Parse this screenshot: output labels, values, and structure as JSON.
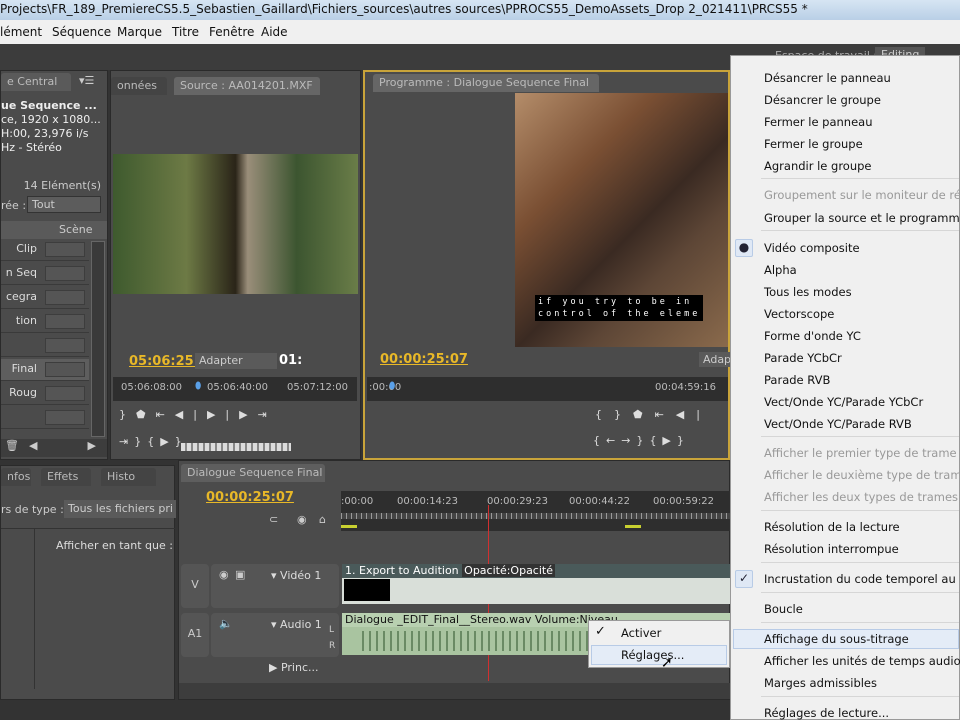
{
  "window": {
    "title": "Projects\\FR_189_PremiereCS5.5_Sebastien_Gaillard\\Fichiers_sources\\autres sources\\PPROCS55_DemoAssets_Drop 2_021411\\PRCS55 *"
  },
  "menu": [
    "lément",
    "Séquence",
    "Marque",
    "Titre",
    "Fenêtre",
    "Aide"
  ],
  "workspace": {
    "label": "Espace de travail :",
    "value": "Editing"
  },
  "project": {
    "tab": "e Central",
    "seq_name": "ue Sequence ...",
    "info1": "ce, 1920 x 1080...",
    "info2": "H:00, 23,976 i/s",
    "info3": "Hz - Stéréo",
    "count": "14 Elément(s)",
    "filter_label": "rée :",
    "filter_value": "Tout",
    "col_scene": "Scène",
    "rows": [
      "Clip",
      "n Seq",
      "cegra",
      "tion",
      "",
      "Final",
      "Roug",
      ""
    ]
  },
  "source": {
    "tab_prev": "onnées",
    "tab": "Source : AA014201.MXF",
    "timecode": "05:06:25:",
    "fit": "Adapter",
    "duration": "01:",
    "ruler": [
      "05:06:08:00",
      "05:06:40:00",
      "05:07:12:00"
    ]
  },
  "program": {
    "tab": "Programme : Dialogue Sequence Final",
    "timecode": "00:00:25:07",
    "fit": "Adap",
    "ruler_start": ":00:00",
    "ruler_end": "00:04:59:16",
    "subtitle1": "if you try to be in",
    "subtitle2": "control of the eleme"
  },
  "lower_left": {
    "tabs": [
      "nfos",
      "Effets",
      "Histo"
    ],
    "type_label": "rs de type :",
    "type_value": "Tous les fichiers pri",
    "display_as": "Afficher en tant que :"
  },
  "timeline": {
    "tab": "Dialogue Sequence Final",
    "timecode": "00:00:25:07",
    "ruler": [
      ":00:00",
      "00:00:14:23",
      "00:00:29:23",
      "00:00:44:22",
      "00:00:59:22"
    ],
    "video_track": {
      "id": "V",
      "name": "Vidéo 1",
      "clip": "1. Export to Audition",
      "fx": "Opacité:Opacité"
    },
    "audio_track": {
      "id": "A1",
      "name": "Audio 1",
      "clip": "Dialogue _EDIT_Final__Stereo.wav",
      "fx": "Volume:Niveau",
      "L": "L",
      "R": "R"
    },
    "master": "Princ..."
  },
  "submenu": {
    "items": [
      {
        "label": "Activer",
        "checked": true
      },
      {
        "label": "Réglages..."
      }
    ]
  },
  "context_menu": {
    "items": [
      {
        "label": "Désancrer le panneau"
      },
      {
        "label": "Désancrer le groupe"
      },
      {
        "label": "Fermer le panneau"
      },
      {
        "label": "Fermer le groupe"
      },
      {
        "label": "Agrandir le groupe"
      },
      {
        "label": "Groupement sur le moniteur de référe",
        "disabled": true
      },
      {
        "label": "Grouper la source et le programme"
      },
      {
        "label": "Vidéo composite",
        "radio": true
      },
      {
        "label": "Alpha"
      },
      {
        "label": "Tous les modes"
      },
      {
        "label": "Vectorscope"
      },
      {
        "label": "Forme d'onde YC"
      },
      {
        "label": "Parade YCbCr"
      },
      {
        "label": "Parade RVB"
      },
      {
        "label": "Vect/Onde YC/Parade YCbCr"
      },
      {
        "label": "Vect/Onde YC/Parade RVB"
      },
      {
        "label": "Afficher le premier type de trame",
        "disabled": true
      },
      {
        "label": "Afficher le deuxième type de trame",
        "disabled": true
      },
      {
        "label": "Afficher les deux types de trames",
        "disabled": true
      },
      {
        "label": "Résolution de la lecture"
      },
      {
        "label": "Résolution interrompue"
      },
      {
        "label": "Incrustation du code temporel au mo",
        "checked": true
      },
      {
        "label": "Boucle"
      },
      {
        "label": "Affichage du sous-titrage",
        "highlighted": true
      },
      {
        "label": "Afficher les unités de temps audio"
      },
      {
        "label": "Marges admissibles"
      },
      {
        "label": "Réglages de lecture..."
      }
    ]
  },
  "colors": {
    "timecode": "#e8b828",
    "accent_border": "#c9a43a",
    "playhead": "#d03030"
  }
}
